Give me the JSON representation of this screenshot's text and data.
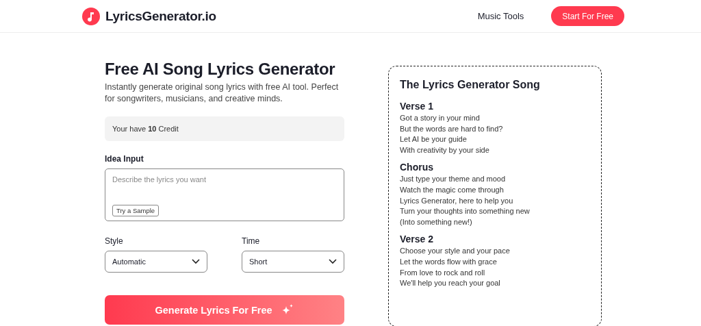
{
  "header": {
    "logo": "LyricsGenerator.io",
    "nav": [
      {
        "label": "Music Tools"
      }
    ],
    "cta": "Start For Free"
  },
  "generator": {
    "title": "Free AI Song Lyrics Generator",
    "subtitle": "Instantly generate original song lyrics with free AI tool. Perfect for songwriters, musicians, and creative minds.",
    "credit": "Your have **10** Credit",
    "idea_label": "Idea Input",
    "idea_placeholder": "Describe the lyrics you want",
    "sample_button": "Try a Sample",
    "selects": [
      {
        "label": "Style",
        "value": "Automatic"
      },
      {
        "label": "Time",
        "value": "Short"
      }
    ],
    "generate_button": "Generate Lyrics For Free"
  },
  "song": {
    "title": "The Lyrics Generator Song",
    "sections": [
      {
        "heading": "Verse 1",
        "lines": [
          "Got a story in your mind",
          "But the words are hard to find?",
          "Let AI be your guide",
          "With creativity by your side"
        ]
      },
      {
        "heading": "Chorus",
        "lines": [
          "Just type your theme and mood",
          "Watch the magic come through",
          "Lyrics Generator, here to help you",
          "Turn your thoughts into something new",
          "(Into something new!)"
        ]
      },
      {
        "heading": "Verse 2",
        "lines": [
          "Choose your style and your pace",
          "Let the words flow with grace",
          "From love to rock and roll",
          "We'll help you reach your goal"
        ]
      }
    ]
  }
}
